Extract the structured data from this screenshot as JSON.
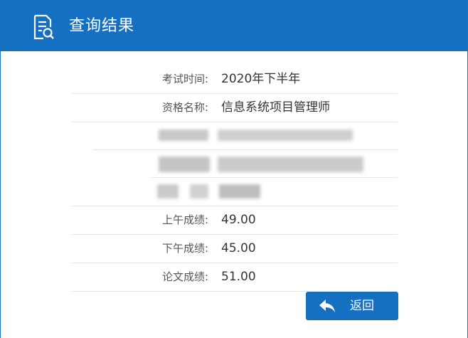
{
  "header": {
    "title": "查询结果",
    "icon": "document-search-icon"
  },
  "results": {
    "exam_time_label": "考试时间:",
    "exam_time_value": "2020年下半年",
    "qualification_label": "资格名称:",
    "qualification_value": "信息系统项目管理师",
    "morning_label": "上午成绩:",
    "morning_value": "49.00",
    "afternoon_label": "下午成绩:",
    "afternoon_value": "45.00",
    "essay_label": "论文成绩:",
    "essay_value": "51.00"
  },
  "actions": {
    "back_label": "返回",
    "back_icon": "reply-arrow-icon"
  },
  "colors": {
    "brand": "#1570c2",
    "divider": "#e3e3e3"
  }
}
